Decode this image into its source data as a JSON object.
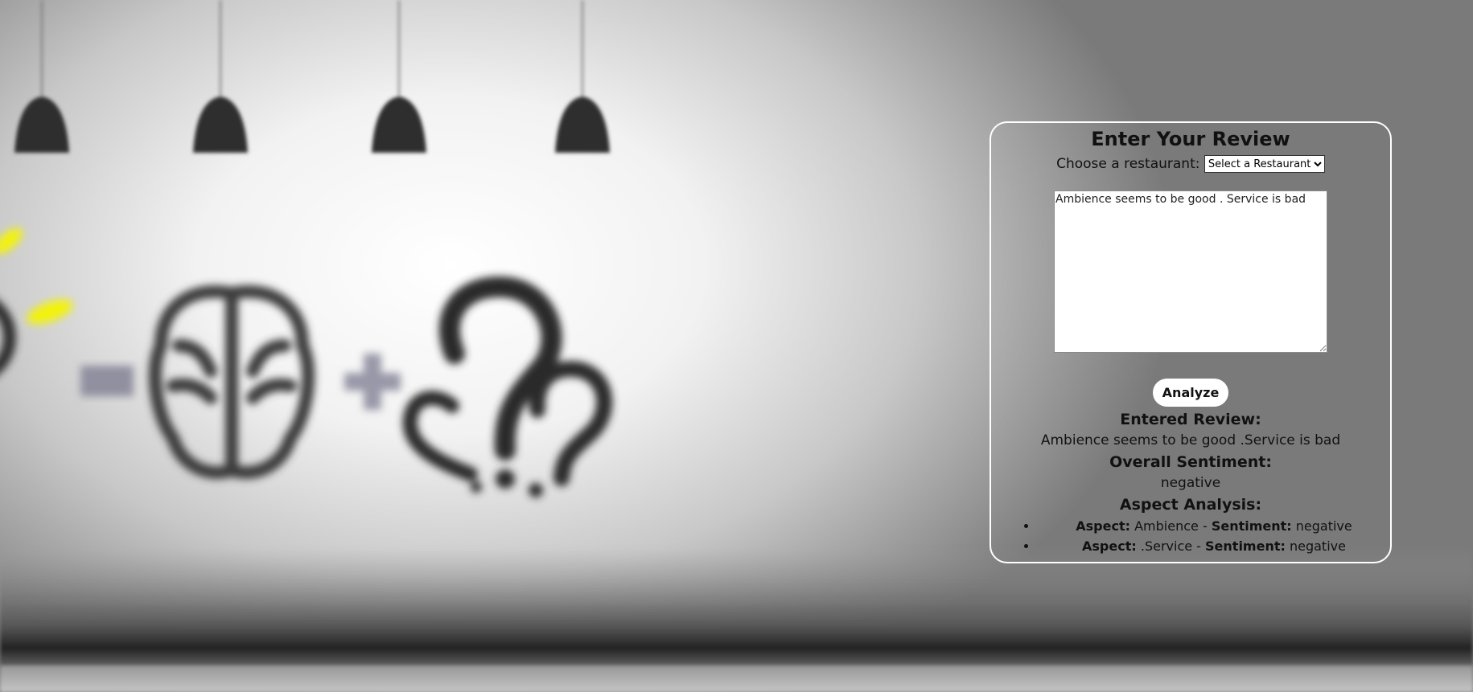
{
  "review_form": {
    "title": "Enter Your Review",
    "restaurant_label": "Choose a restaurant:",
    "restaurant_selected": "Select a Restaurant",
    "review_text": "Ambience seems to be good . Service is bad",
    "analyze_label": "Analyze"
  },
  "results": {
    "entered_heading": "Entered Review:",
    "entered_text": "Ambience seems to be good .Service is bad",
    "overall_heading": "Overall Sentiment:",
    "overall_value": "negative",
    "aspect_heading": "Aspect Analysis:",
    "aspect_label": "Aspect:",
    "sentiment_label": "Sentiment:",
    "aspects": [
      {
        "aspect": "Ambience",
        "sentiment": "negative"
      },
      {
        "aspect": ".Service",
        "sentiment": "negative"
      }
    ]
  },
  "colors": {
    "panel_border": "#ffffff",
    "button_bg": "#ffffff",
    "accent_yellow": "#f2f20a"
  },
  "background": {
    "icons": [
      "pendant-lamp-icon",
      "lightbulb-icon",
      "minus-icon",
      "brain-icon",
      "plus-icon",
      "question-marks-icon"
    ]
  }
}
